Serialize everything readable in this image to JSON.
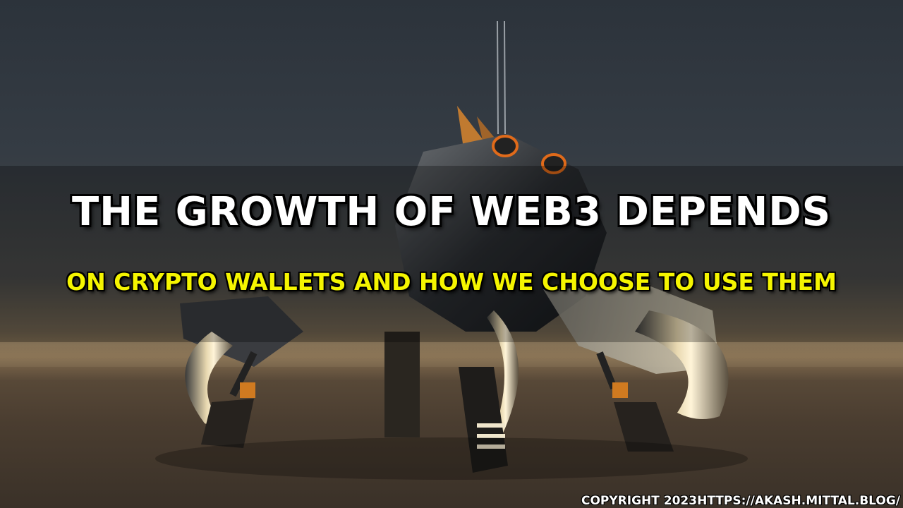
{
  "banner": {
    "title": "THE GROWTH OF WEB3 DEPENDS",
    "subtitle": "ON CRYPTO WALLETS AND HOW WE CHOOSE TO USE THEM",
    "copyright": "COPYRIGHT 2023HTTPS://AKASH.MITTAL.BLOG/"
  },
  "background": {
    "subject": "robot-spider-illustration",
    "sky_color": "#2c333b",
    "ground_color": "#4a3d30",
    "accent_orange": "#e06a1a"
  },
  "colors": {
    "title": "#ffffff",
    "subtitle": "#f5f500",
    "outline": "#000000"
  }
}
